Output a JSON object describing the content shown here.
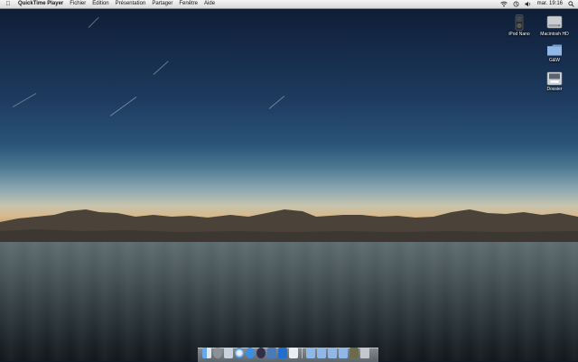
{
  "menubar": {
    "app_name": "QuickTime Player",
    "items": [
      "Fichier",
      "Édition",
      "Présentation",
      "Partager",
      "Fenêtre",
      "Aide"
    ],
    "clock": "mar. 19:16",
    "status_icons": [
      "wifi-icon",
      "sync-icon",
      "volume-icon",
      "spotlight-icon"
    ]
  },
  "desktop": {
    "icons": [
      {
        "label": "iPod Nano",
        "icon": "ipod-icon"
      },
      {
        "label": "Macintosh HD",
        "icon": "hard-drive-icon"
      },
      {
        "label": "G&W",
        "icon": "folder-icon"
      },
      {
        "label": "Dossier",
        "icon": "disk-icon"
      }
    ]
  },
  "dock": {
    "items": [
      "finder-icon",
      "system-preferences-icon",
      "mail-icon",
      "safari-icon",
      "app-store-icon",
      "itunes-icon",
      "iphoto-icon",
      "xcode-icon",
      "preview-icon",
      "folder-icon",
      "folder-icon",
      "folder-icon",
      "folder-icon",
      "utility-icon",
      "trash-icon"
    ]
  },
  "colors": {
    "menubar_bg": "#e6e6e6",
    "folder_blue": "#8fb8e6",
    "sky_top": "#0d1b30",
    "horizon": "#d8b98a"
  }
}
